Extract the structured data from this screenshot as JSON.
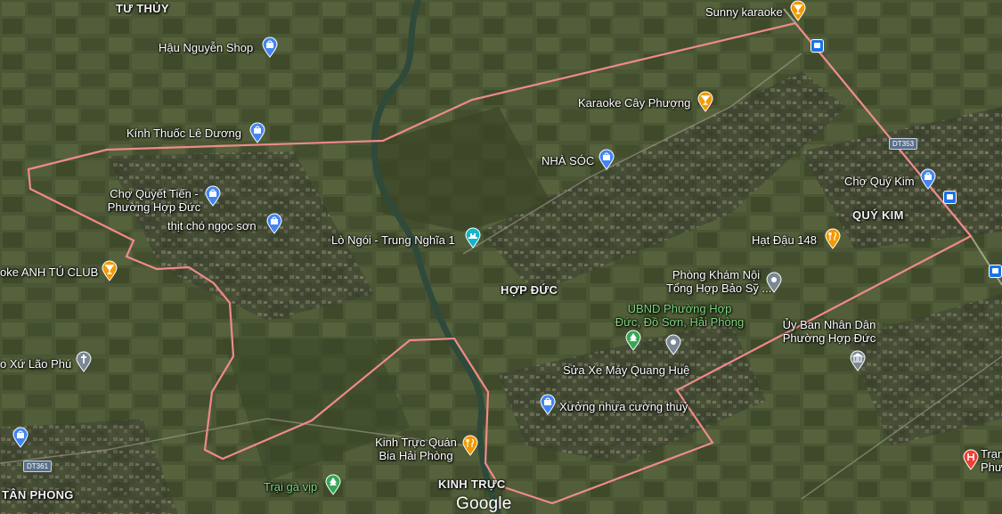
{
  "map": {
    "logo": "Google",
    "areas": {
      "tu_thuy": "TƯ THỦY",
      "quy_kim": "QUÝ KIM",
      "hop_duc": "HỢP ĐỨC",
      "kinh_truc": "KINH TRỰC",
      "tan_phong": "TÂN PHONG"
    },
    "places": {
      "sunny_karaoke": "Sunny karaoke",
      "hau_nguyen_shop": "Hậu Nguyễn Shop",
      "karaoke_cay_phuong": "Karaoke Cây Phượng",
      "kinh_thuoc": "Kính Thuốc Lê Dương",
      "nha_soc": "NHÀ SÓC",
      "cho_quy_kim": "Chợ Quý Kim",
      "cho_quyet_tien_1": "Chợ Quyết Tiến -",
      "cho_quyet_tien_2": "Phường Hợp Đức",
      "thit_cho": "thịt chó ngọc sơn",
      "lo_ngoi": "Lò Ngói - Trung Nghĩa 1",
      "hat_dau": "Hạt Đậu 148",
      "karaoke_anh_tu": "oke ANH TÚ CLUB",
      "phong_kham_1": "Phòng Khám Nội",
      "phong_kham_2": "Tổng Hợp Bảo Sỹ ...",
      "ubnd_1": "UBND Phường Hợp",
      "ubnd_2": "Đức, Đồ Sơn, Hải Phòng",
      "uy_ban_1": "Ủy Ban Nhân Dân",
      "uy_ban_2": "Phường Hợp Đức",
      "xu_lao_phu": "o Xứ Lão Phú",
      "sua_xe": "Sửa Xe Máy Quang Huệ",
      "xuong_nhua": "Xưởng nhựa cường thuỷ",
      "kinh_truc_quan_1": "Kinh Trực Quán",
      "kinh_truc_quan_2": "Bia Hải Phòng",
      "trai_ga": "Trại gà vịp",
      "tram_1": "Trạn",
      "tram_2": "Phư"
    },
    "roads": {
      "dt353": "DT353",
      "dt361": "DT361"
    },
    "colors": {
      "boundary": "#f08a8a",
      "karaoke_pin": "#f29900",
      "shop_pin": "#4285f4",
      "park_pin": "#34a853",
      "civic_pin": "#7b8794",
      "hospital_pin": "#ea4335",
      "attraction_pin": "#12b5cb"
    }
  }
}
